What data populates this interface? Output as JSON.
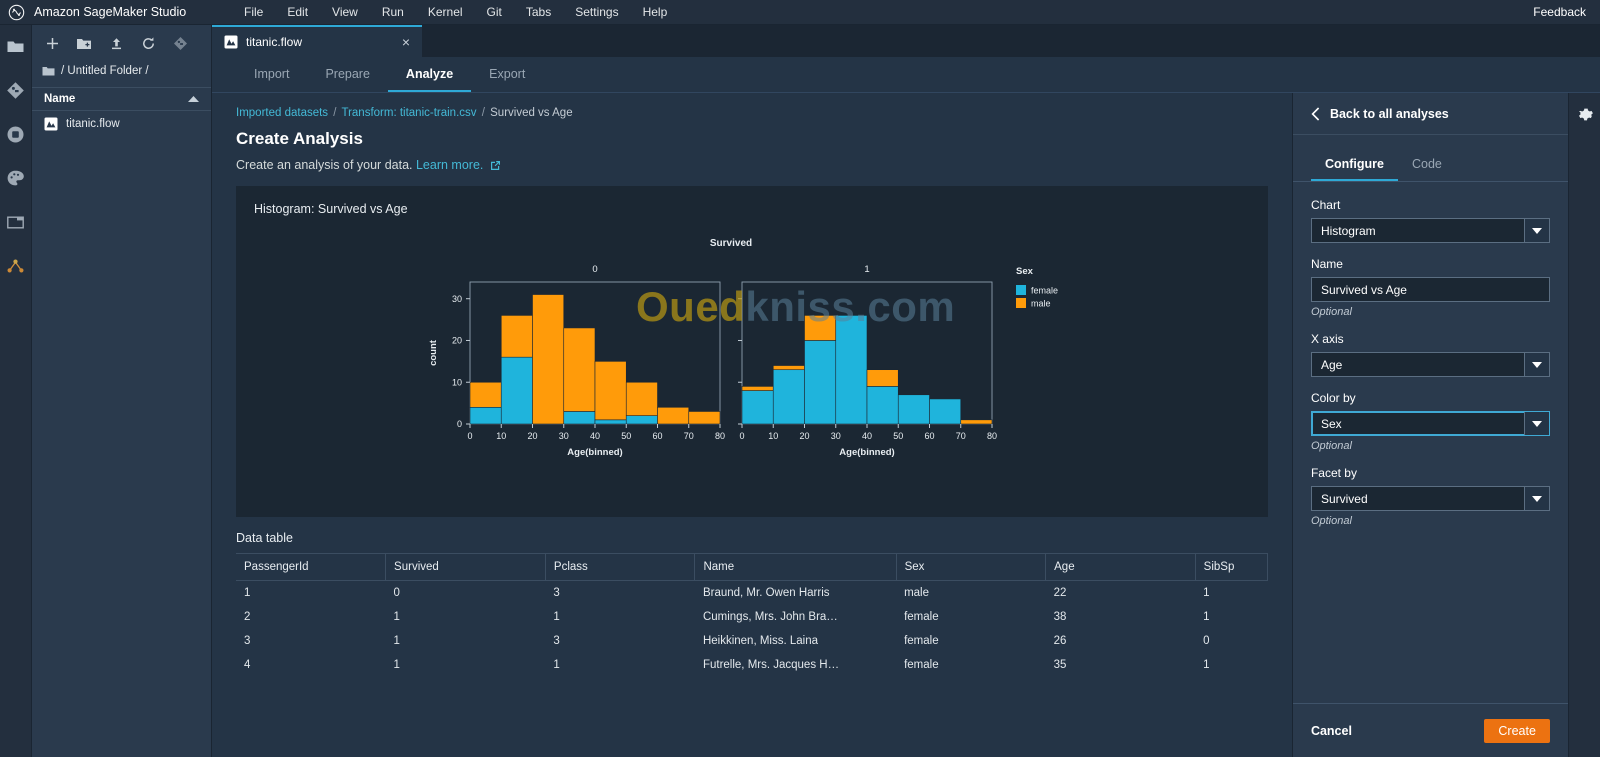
{
  "app": {
    "brand": "Amazon SageMaker Studio",
    "feedback": "Feedback",
    "menu": [
      "File",
      "Edit",
      "View",
      "Run",
      "Kernel",
      "Git",
      "Tabs",
      "Settings",
      "Help"
    ]
  },
  "file_browser": {
    "path": "/ Untitled Folder /",
    "column_header": "Name",
    "files": [
      "titanic.flow"
    ]
  },
  "tab": {
    "title": "titanic.flow",
    "close": "×"
  },
  "subtabs": [
    {
      "label": "Import",
      "active": false
    },
    {
      "label": "Prepare",
      "active": false
    },
    {
      "label": "Analyze",
      "active": true
    },
    {
      "label": "Export",
      "active": false
    }
  ],
  "breadcrumb": {
    "item1": "Imported datasets",
    "item2": "Transform: titanic-train.csv",
    "item3": "Survived vs Age",
    "sep": "/"
  },
  "page": {
    "title": "Create Analysis",
    "subtitle": "Create an analysis of your data.",
    "learn_more": "Learn more."
  },
  "chart_card": {
    "title": "Histogram: Survived vs Age"
  },
  "watermark": {
    "part1": "Oued",
    "part2": "kniss.com"
  },
  "data_table": {
    "title": "Data table",
    "columns": [
      "PassengerId",
      "Survived",
      "Pclass",
      "Name",
      "Sex",
      "Age",
      "SibSp"
    ],
    "rows": [
      [
        "1",
        "0",
        "3",
        "Braund, Mr. Owen Harris",
        "male",
        "22",
        "1"
      ],
      [
        "2",
        "1",
        "1",
        "Cumings, Mrs. John Bra…",
        "female",
        "38",
        "1"
      ],
      [
        "3",
        "1",
        "3",
        "Heikkinen, Miss. Laina",
        "female",
        "26",
        "0"
      ],
      [
        "4",
        "1",
        "1",
        "Futrelle, Mrs. Jacques H…",
        "female",
        "35",
        "1"
      ]
    ]
  },
  "right_panel": {
    "back": "Back to all analyses",
    "tabs": [
      {
        "label": "Configure",
        "active": true
      },
      {
        "label": "Code",
        "active": false
      }
    ],
    "fields": {
      "chart": {
        "label": "Chart",
        "value": "Histogram"
      },
      "name": {
        "label": "Name",
        "value": "Survived vs Age",
        "hint": "Optional"
      },
      "x_axis": {
        "label": "X axis",
        "value": "Age"
      },
      "color_by": {
        "label": "Color by",
        "value": "Sex",
        "hint": "Optional"
      },
      "facet_by": {
        "label": "Facet by",
        "value": "Survived",
        "hint": "Optional"
      }
    },
    "cancel": "Cancel",
    "create": "Create"
  },
  "colors": {
    "accent_cyan": "#2ea9d6",
    "accent_orange": "#ec7211",
    "bar_female": "#1fb4dc",
    "bar_male": "#ff9b0a",
    "panel_bg": "#2a3a4d",
    "content_bg": "#243446",
    "chart_bg": "#1b2733"
  },
  "chart_data": {
    "type": "bar",
    "title": "Survived",
    "xlabel": "Age(binned)",
    "ylabel": "count",
    "xlim": [
      0,
      80
    ],
    "ylim": [
      0,
      34
    ],
    "xticks": [
      0,
      10,
      20,
      30,
      40,
      50,
      60,
      70,
      80
    ],
    "yticks": [
      0,
      10,
      20,
      30
    ],
    "grid": false,
    "stacked": true,
    "legend": {
      "title": "Sex",
      "position": "right",
      "entries": [
        {
          "label": "female",
          "color": "#1fb4dc"
        },
        {
          "label": "male",
          "color": "#ff9b0a"
        }
      ]
    },
    "facet_by": "Survived",
    "facets": [
      {
        "label": "0",
        "bins": [
          {
            "x0": 0,
            "x1": 10,
            "female": 4,
            "male": 6,
            "total": 10
          },
          {
            "x0": 10,
            "x1": 20,
            "female": 16,
            "male": 10,
            "total": 26
          },
          {
            "x0": 20,
            "x1": 30,
            "female": 0,
            "male": 31,
            "total": 31
          },
          {
            "x0": 30,
            "x1": 40,
            "female": 3,
            "male": 20,
            "total": 23
          },
          {
            "x0": 40,
            "x1": 50,
            "female": 1,
            "male": 14,
            "total": 15
          },
          {
            "x0": 50,
            "x1": 60,
            "female": 2,
            "male": 8,
            "total": 10
          },
          {
            "x0": 60,
            "x1": 70,
            "female": 0,
            "male": 4,
            "total": 4
          },
          {
            "x0": 70,
            "x1": 80,
            "female": 0,
            "male": 3,
            "total": 3
          }
        ]
      },
      {
        "label": "1",
        "bins": [
          {
            "x0": 0,
            "x1": 10,
            "female": 8,
            "male": 1,
            "total": 9
          },
          {
            "x0": 10,
            "x1": 20,
            "female": 13,
            "male": 1,
            "total": 14
          },
          {
            "x0": 20,
            "x1": 30,
            "female": 20,
            "male": 6,
            "total": 26
          },
          {
            "x0": 30,
            "x1": 40,
            "female": 26,
            "male": 0,
            "total": 26
          },
          {
            "x0": 40,
            "x1": 50,
            "female": 9,
            "male": 4,
            "total": 13
          },
          {
            "x0": 50,
            "x1": 60,
            "female": 7,
            "male": 0,
            "total": 7
          },
          {
            "x0": 60,
            "x1": 70,
            "female": 6,
            "male": 0,
            "total": 6
          },
          {
            "x0": 70,
            "x1": 80,
            "female": 0,
            "male": 1,
            "total": 1
          }
        ]
      }
    ]
  }
}
